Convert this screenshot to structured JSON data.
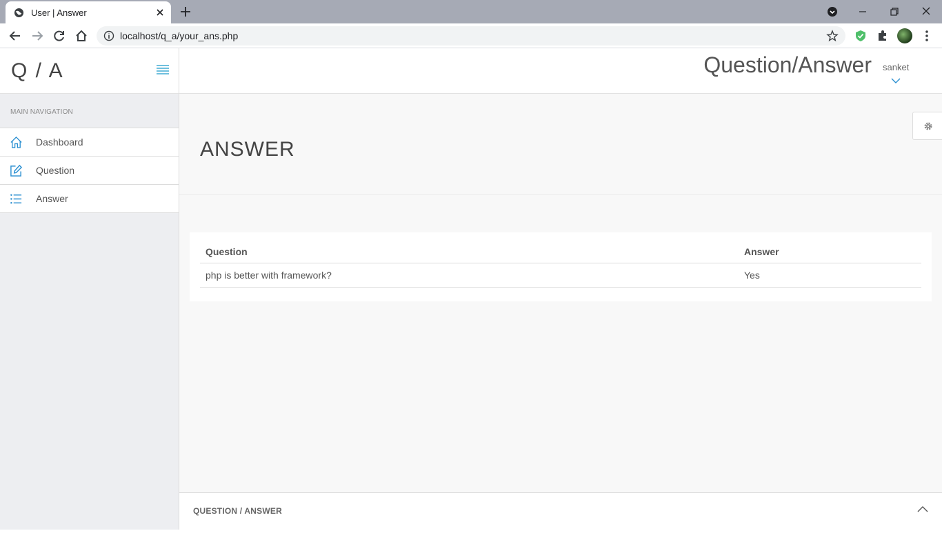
{
  "browser": {
    "tab_title": "User | Answer",
    "url": "localhost/q_a/your_ans.php"
  },
  "sidebar": {
    "logo": "Q / A",
    "nav_heading": "MAIN NAVIGATION",
    "items": [
      {
        "label": "Dashboard",
        "icon": "home-icon"
      },
      {
        "label": "Question",
        "icon": "edit-icon"
      },
      {
        "label": "Answer",
        "icon": "list-icon"
      }
    ]
  },
  "header": {
    "app_title": "Question/Answer",
    "user_name": "sanket"
  },
  "main": {
    "page_title": "ANSWER",
    "table": {
      "columns": [
        "Question",
        "Answer"
      ],
      "rows": [
        [
          "php is better with framework?",
          "Yes"
        ]
      ]
    }
  },
  "footer": {
    "text": "QUESTION / ANSWER"
  },
  "colors": {
    "accent": "#2a8fd1",
    "chrome_bg": "#a6aab5",
    "sidebar_bg": "#edeef1",
    "page_bg": "#f8f8f8"
  }
}
